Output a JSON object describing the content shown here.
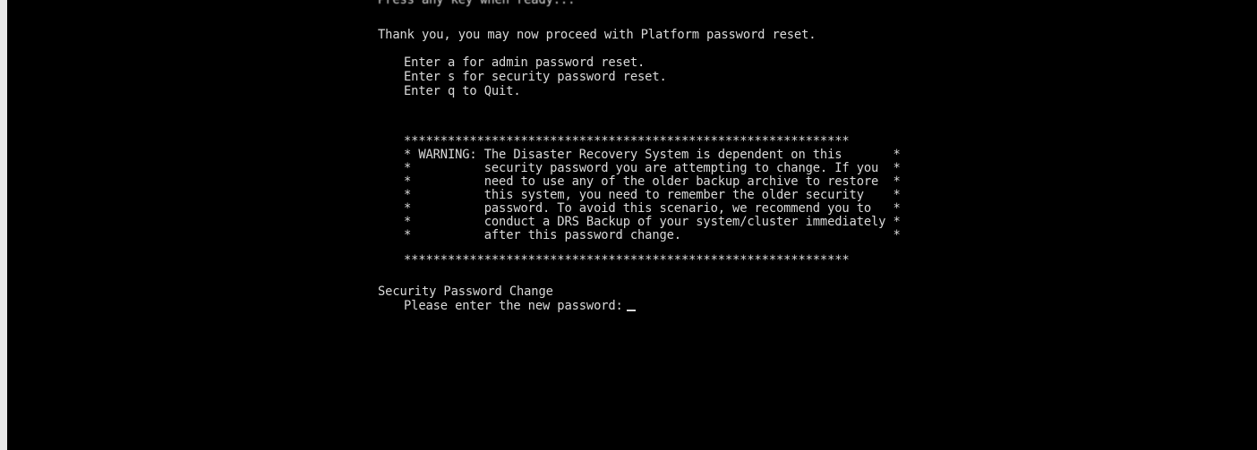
{
  "terminal": {
    "lines": {
      "cut_off": "Press any key when ready...",
      "thank_you": "Thank you, you may now proceed with Platform password reset.",
      "opt_a": "Enter a for admin password reset.",
      "opt_s": "Enter s for security password reset.",
      "opt_q": "Enter q to Quit."
    },
    "warning_box": {
      "border": "*************************************************************",
      "rows": [
        "* WARNING: The Disaster Recovery System is dependent on this       *",
        "*          security password you are attempting to change. If you  *",
        "*          need to use any of the older backup archive to restore  *",
        "*          this system, you need to remember the older security    *",
        "*          password. To avoid this scenario, we recommend you to   *",
        "*          conduct a DRS Backup of your system/cluster immediately *",
        "*          after this password change.                             *"
      ]
    },
    "section_title": "Security Password Change",
    "prompt": "Please enter the new password:"
  },
  "colors": {
    "background": "#000000",
    "text": "#d9d9d9",
    "left_edge": "#e9e9e9"
  }
}
